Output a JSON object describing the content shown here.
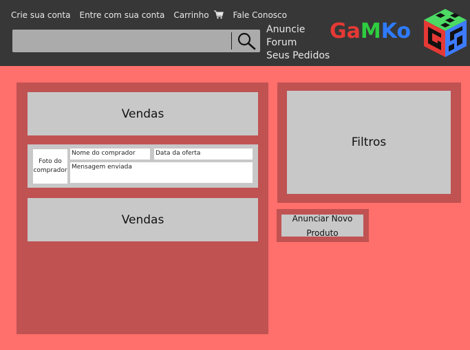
{
  "header": {
    "links": [
      "Crie sua conta",
      "Entre com sua conta",
      "Carrinho",
      "Fale Conosco"
    ],
    "cart_icon": "cart-icon",
    "search": {
      "placeholder": "",
      "icon": "search-icon"
    },
    "side_links": [
      "Anuncie",
      "Forum",
      "Seus Pedidos"
    ],
    "brand": {
      "letters": [
        "G",
        "a",
        "M",
        "K",
        "o"
      ],
      "colors": [
        "#e53935",
        "#e53935",
        "#2ecc40",
        "#2e7bff",
        "#2e7bff"
      ]
    }
  },
  "left_panel": {
    "vendas_top": "Vendas",
    "offer": {
      "photo_label": "Foto do comprador",
      "buyer_name": "Nome do comprador",
      "offer_date": "Data da oferta",
      "message": "Mensagem enviada"
    },
    "vendas_bottom": "Vendas"
  },
  "right_panel": {
    "filters": "Filtros"
  },
  "new_product_button": "Anunciar Novo Produto",
  "colors": {
    "background": "#ff6f6b",
    "panel": "#c05252",
    "box": "#c8c8c8",
    "header": "#373737"
  }
}
